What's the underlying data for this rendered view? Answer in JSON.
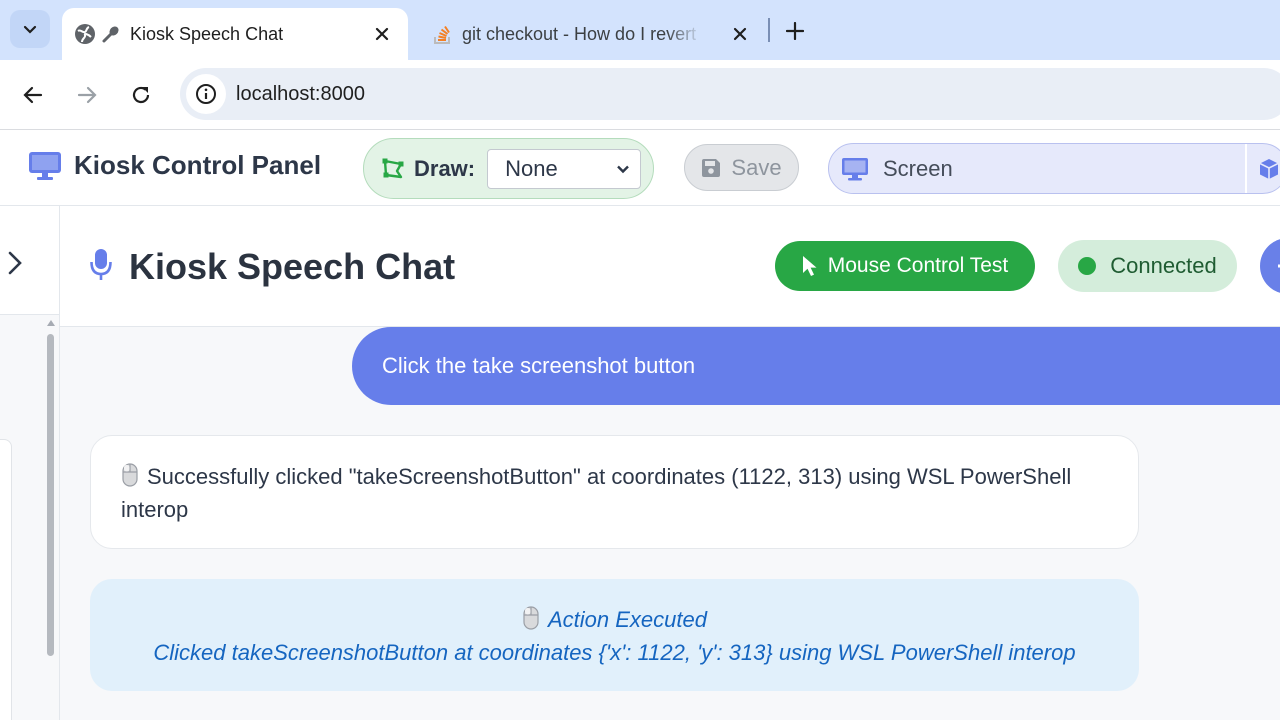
{
  "browser": {
    "tabs": [
      {
        "title": "Kiosk Speech Chat",
        "favicon": "globe-icon",
        "active": true
      },
      {
        "title": "git checkout - How do I revert a",
        "favicon": "stackoverflow-icon",
        "active": false
      }
    ],
    "url": "localhost:8000"
  },
  "header": {
    "brand_title": "Kiosk Control Panel",
    "draw_label": "Draw:",
    "draw_value": "None",
    "save_label": "Save",
    "screen_label": "Screen"
  },
  "chat": {
    "title": "Kiosk Speech Chat",
    "mouse_test_label": "Mouse Control Test",
    "status_label": "Connected",
    "messages": [
      {
        "role": "user",
        "text": "Click the take screenshot button"
      },
      {
        "role": "assistant",
        "text": "Successfully clicked \"takeScreenshotButton\" at coordinates (1122, 313) using WSL PowerShell interop"
      },
      {
        "role": "action",
        "title": "Action Executed",
        "detail": "Clicked takeScreenshotButton at coordinates {'x': 1122, 'y': 313} using WSL PowerShell interop"
      }
    ]
  },
  "colors": {
    "accent": "#667eea",
    "success": "#28a745",
    "action_text": "#1565c0"
  }
}
